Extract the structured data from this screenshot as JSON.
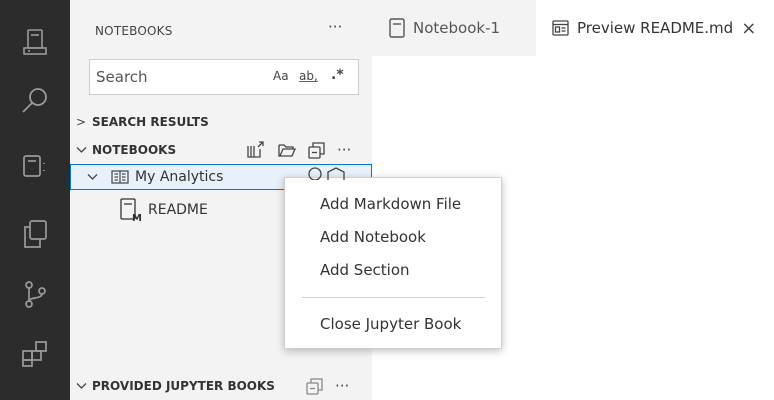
{
  "activity_bar": {
    "icons": [
      "notebook-icon",
      "search-icon",
      "notebooks-view-icon",
      "explorer-icon",
      "source-control-icon",
      "extensions-icon"
    ]
  },
  "sidebar": {
    "title": "NOTEBOOKS",
    "more": "···",
    "search": {
      "placeholder": "Search",
      "match_case": "Aa",
      "whole_word": "ab",
      "regex": ".*"
    },
    "sections": {
      "search_results": "SEARCH RESULTS",
      "notebooks": "NOTEBOOKS",
      "provided": "PROVIDED JUPYTER BOOKS"
    },
    "tree": {
      "book": "My Analytics",
      "child": "README"
    }
  },
  "tabs": [
    {
      "label": "Notebook-1"
    },
    {
      "label": "Preview README.md",
      "close": "×"
    }
  ],
  "context_menu": {
    "items": [
      "Add Markdown File",
      "Add Notebook",
      "Add Section",
      "Close Jupyter Book"
    ]
  },
  "colors": {
    "activity_bg": "#2c2c2c",
    "sidebar_bg": "#f3f3f3",
    "accent": "#0078d4"
  }
}
